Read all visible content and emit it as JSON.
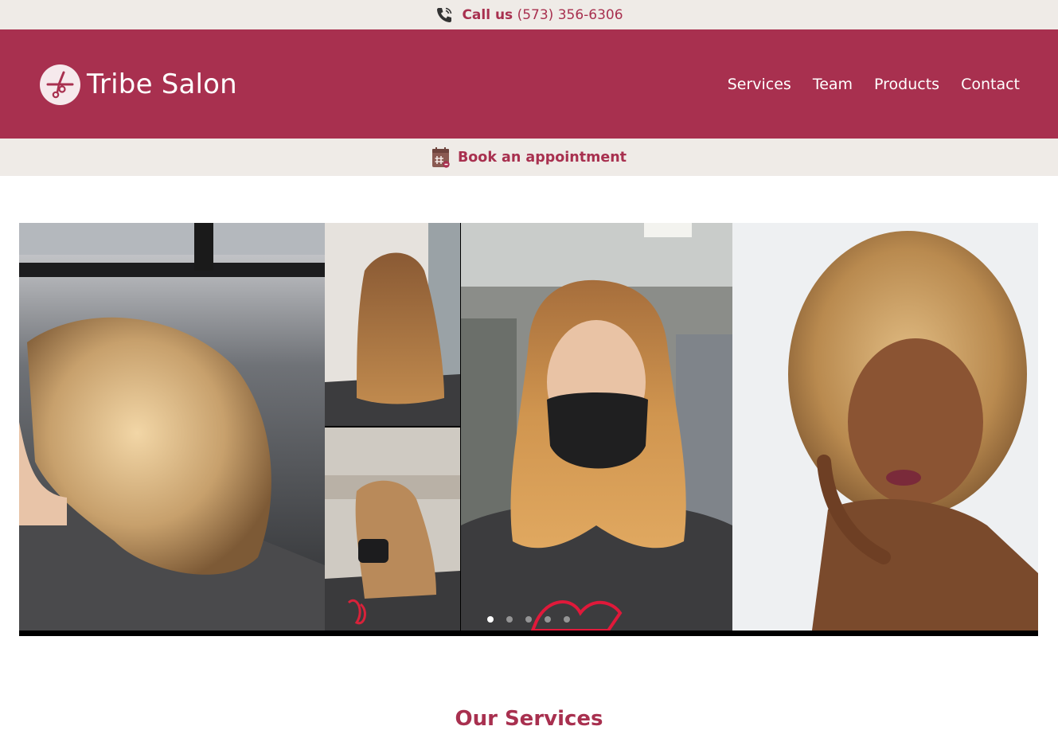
{
  "topbar": {
    "call_label": "Call us",
    "phone_number": "(573) 356-6306",
    "icon": "phone-icon"
  },
  "header": {
    "brand_name": "Tribe Salon",
    "logo_icon": "scissors-icon",
    "nav": [
      {
        "label": "Services"
      },
      {
        "label": "Team"
      },
      {
        "label": "Products"
      },
      {
        "label": "Contact"
      }
    ]
  },
  "booking": {
    "label": "Book an appointment",
    "icon": "calendar-icon"
  },
  "slider": {
    "photos": [
      "blonde-bob-photo",
      "before-after-collage-photo",
      "masked-client-photo",
      "curly-hair-model-photo"
    ],
    "dot_count": 5,
    "active_dot": 0
  },
  "services": {
    "heading": "Our Services"
  },
  "colors": {
    "brand": "#a8304f",
    "cream": "#efebe7",
    "white": "#ffffff"
  }
}
